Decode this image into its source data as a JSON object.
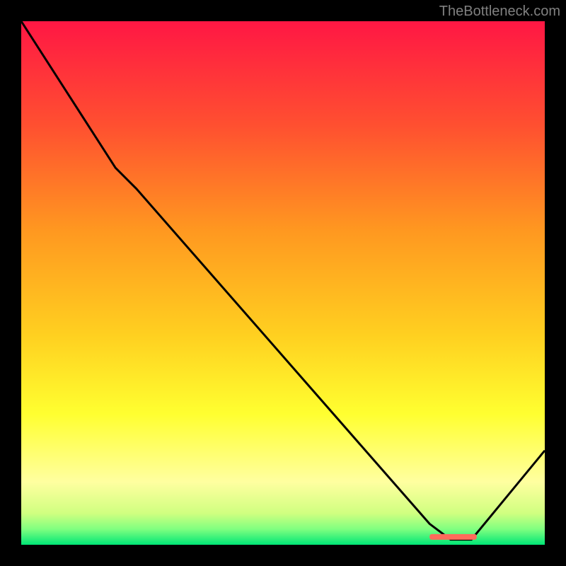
{
  "attribution": "TheBottleneck.com",
  "chart_data": {
    "type": "line",
    "title": "",
    "xlabel": "",
    "ylabel": "",
    "xlim": [
      0,
      100
    ],
    "ylim": [
      0,
      100
    ],
    "gradient_stops": [
      {
        "offset": 0,
        "color": "#ff1744"
      },
      {
        "offset": 20,
        "color": "#ff5030"
      },
      {
        "offset": 40,
        "color": "#ff9820"
      },
      {
        "offset": 60,
        "color": "#ffd020"
      },
      {
        "offset": 75,
        "color": "#ffff30"
      },
      {
        "offset": 88,
        "color": "#ffffa0"
      },
      {
        "offset": 94,
        "color": "#d0ff80"
      },
      {
        "offset": 97,
        "color": "#80ff80"
      },
      {
        "offset": 100,
        "color": "#00e676"
      }
    ],
    "curve": [
      {
        "x": 0,
        "y": 100
      },
      {
        "x": 18,
        "y": 72
      },
      {
        "x": 22,
        "y": 68
      },
      {
        "x": 78,
        "y": 4
      },
      {
        "x": 82,
        "y": 1
      },
      {
        "x": 86,
        "y": 1
      },
      {
        "x": 100,
        "y": 18
      }
    ],
    "marker": {
      "x_start": 78,
      "x_end": 87,
      "y": 1.5,
      "color": "#ff6b5b"
    }
  }
}
